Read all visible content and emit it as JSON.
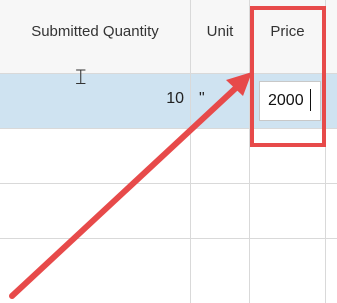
{
  "table": {
    "headers": {
      "submitted_quantity": "Submitted Quantity",
      "unit": "Unit",
      "price": "Price"
    },
    "selected_row": {
      "submitted_quantity": "10",
      "unit": "\"",
      "price_value": "2000"
    }
  },
  "colors": {
    "highlight": "#e74a4a",
    "selected_row": "#cfe3f1"
  },
  "icons": {
    "cursor": "text-cursor-icon",
    "annotation": "red-arrow"
  }
}
